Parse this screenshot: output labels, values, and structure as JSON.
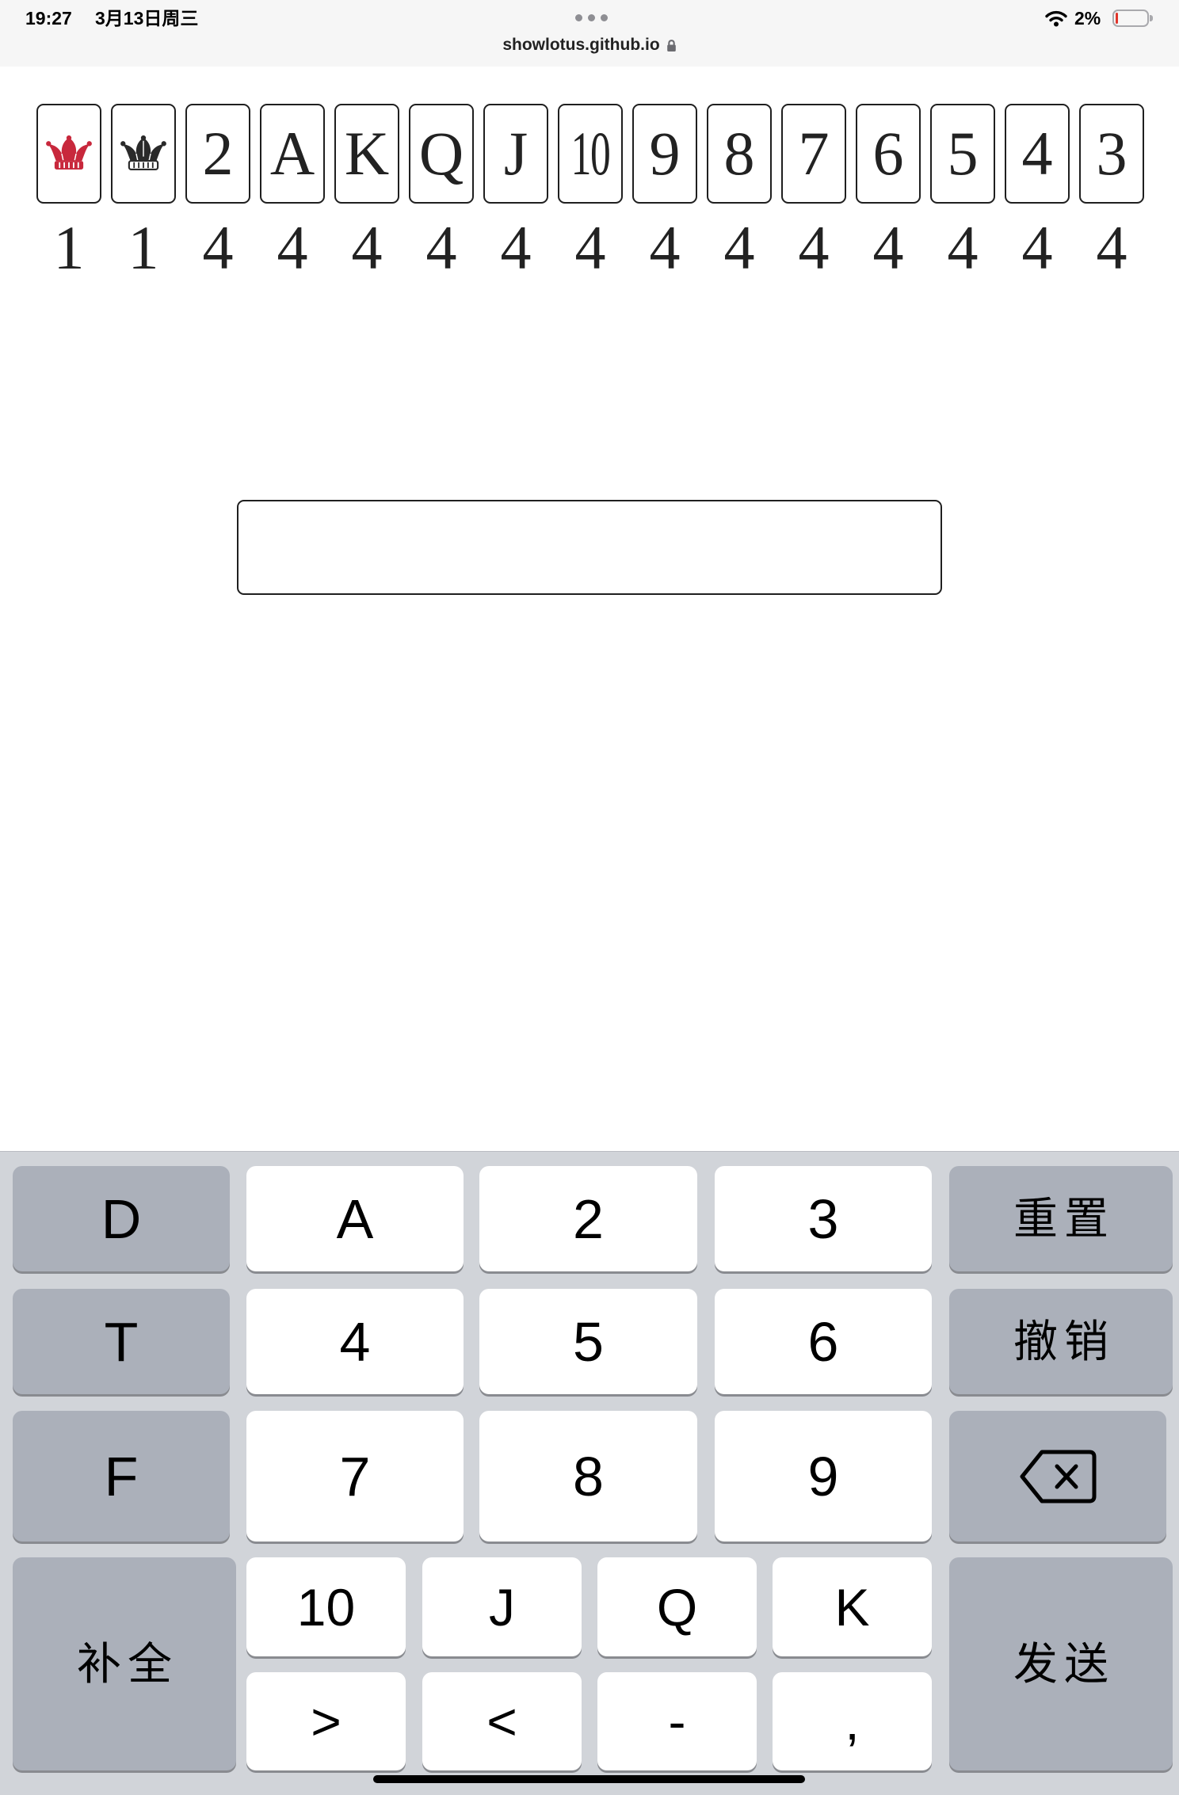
{
  "status_bar": {
    "time": "19:27",
    "date": "3月13日周三",
    "url": "showlotus.github.io",
    "battery_percent": "2%",
    "battery_level": 0.02,
    "icons": {
      "menu": "more-dots-icon",
      "lock": "lock-icon",
      "wifi": "wifi-icon",
      "battery": "battery-icon"
    }
  },
  "theme": {
    "keyboard_bg": "#d1d4d9",
    "key_gray": "#abb0ba",
    "key_white": "#ffffff",
    "ink": "#1f1f1f"
  },
  "cards": [
    {
      "icon": "red-joker-icon",
      "color": "#c8283c",
      "count": "1"
    },
    {
      "icon": "black-joker-icon",
      "color": "#2a2a2a",
      "count": "1"
    },
    {
      "rank": "2",
      "count": "4"
    },
    {
      "rank": "A",
      "count": "4"
    },
    {
      "rank": "K",
      "count": "4"
    },
    {
      "rank": "Q",
      "count": "4"
    },
    {
      "rank": "J",
      "count": "4"
    },
    {
      "rank": "10",
      "count": "4"
    },
    {
      "rank": "9",
      "count": "4"
    },
    {
      "rank": "8",
      "count": "4"
    },
    {
      "rank": "7",
      "count": "4"
    },
    {
      "rank": "6",
      "count": "4"
    },
    {
      "rank": "5",
      "count": "4"
    },
    {
      "rank": "4",
      "count": "4"
    },
    {
      "rank": "3",
      "count": "4"
    }
  ],
  "input": {
    "value": ""
  },
  "keyboard": {
    "left": [
      "D",
      "T",
      "F",
      "补全"
    ],
    "right": [
      {
        "label": "重置"
      },
      {
        "label": "撤销"
      },
      {
        "icon": "backspace-icon"
      },
      {
        "label": "发送"
      }
    ],
    "rows": [
      [
        "A",
        "2",
        "3"
      ],
      [
        "4",
        "5",
        "6"
      ],
      [
        "7",
        "8",
        "9"
      ]
    ],
    "bottom_upper": [
      "10",
      "J",
      "Q",
      "K"
    ],
    "bottom_lower": [
      ">",
      "<",
      "-",
      ","
    ]
  }
}
